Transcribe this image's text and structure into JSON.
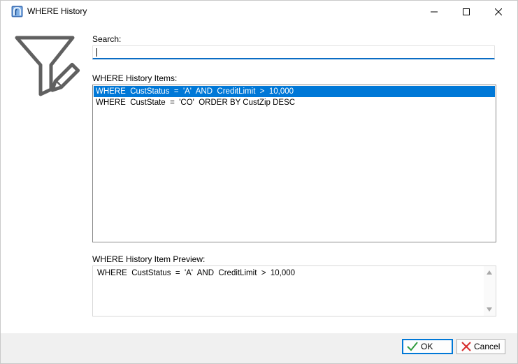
{
  "window": {
    "title": "WHERE History"
  },
  "icons": {
    "app": "database-filter-icon",
    "hero": "funnel-pencil-icon",
    "minimize": "minimize-icon",
    "maximize": "maximize-icon",
    "close": "close-icon",
    "ok": "checkmark-icon",
    "cancel": "x-icon"
  },
  "search": {
    "label": "Search:",
    "value": ""
  },
  "history": {
    "label": "WHERE History Items:",
    "items": [
      {
        "text": "WHERE  CustStatus  =  'A'  AND  CreditLimit  >  10,000",
        "selected": true
      },
      {
        "text": "WHERE  CustState  =  'CO'  ORDER BY CustZip DESC",
        "selected": false
      }
    ]
  },
  "preview": {
    "label": "WHERE History Item Preview:",
    "text": "WHERE  CustStatus  =  'A'  AND  CreditLimit  >  10,000"
  },
  "buttons": {
    "ok_label": "OK",
    "cancel_label": "Cancel"
  },
  "colors": {
    "selection": "#0078d7",
    "ok_check": "#2e9b3e",
    "cancel_x": "#d62e2e",
    "focus_underline": "#0a6cc4"
  }
}
